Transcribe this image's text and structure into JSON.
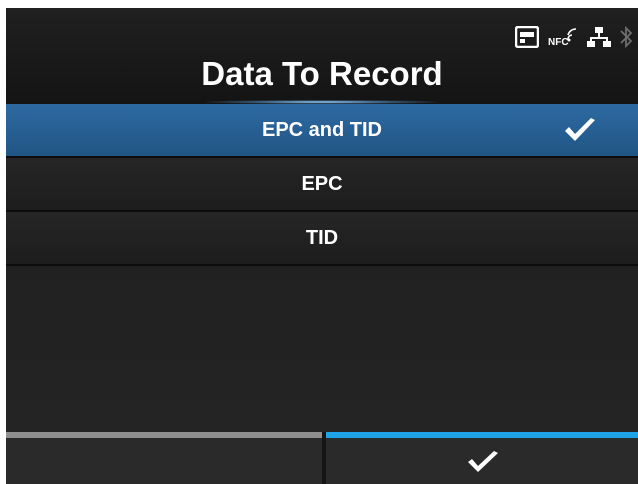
{
  "header": {
    "title": "Data To Record",
    "status_icons": [
      "sd-card-icon",
      "nfc-icon",
      "network-icon",
      "bluetooth-icon"
    ],
    "nfc_label": "NFC"
  },
  "menu": {
    "items": [
      {
        "label": "EPC and TID",
        "selected": true
      },
      {
        "label": "EPC",
        "selected": false
      },
      {
        "label": "TID",
        "selected": false
      }
    ]
  },
  "footer": {
    "left_button": {
      "icon": "none"
    },
    "right_button": {
      "icon": "check-icon"
    }
  },
  "colors": {
    "selected_row": "#2a629a",
    "footer_accent": "#1ea4e6",
    "footer_left_bar": "#8f8f8f"
  }
}
